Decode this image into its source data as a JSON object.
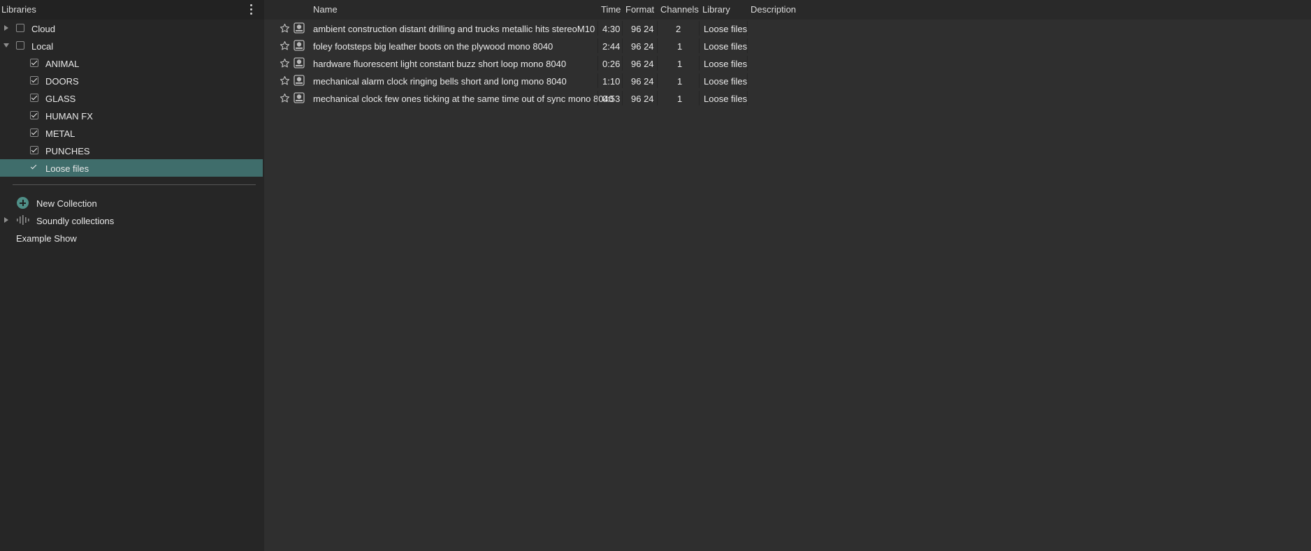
{
  "sidebar": {
    "title": "Libraries",
    "menu_icon": "vertical-ellipsis-icon",
    "tree": [
      {
        "label": "Cloud",
        "expanded": false,
        "checked": false
      },
      {
        "label": "Local",
        "expanded": true,
        "checked": false
      },
      {
        "label": "ANIMAL",
        "checked": true
      },
      {
        "label": "DOORS",
        "checked": true
      },
      {
        "label": "GLASS",
        "checked": true
      },
      {
        "label": "HUMAN FX",
        "checked": true
      },
      {
        "label": "METAL",
        "checked": true
      },
      {
        "label": "PUNCHES",
        "checked": true
      },
      {
        "label": "Loose files",
        "checked": true,
        "selected": true
      }
    ],
    "new_collection_label": "New Collection",
    "soundly_collections_label": "Soundly collections",
    "example_show_label": "Example Show"
  },
  "list": {
    "columns": [
      "Name",
      "Time",
      "Format",
      "Channels",
      "Library",
      "Description"
    ],
    "rows": [
      {
        "name": "ambient construction distant drilling and trucks metallic hits stereoM10",
        "time": "4:30",
        "format": "96 24",
        "channels": "2",
        "library": "Loose files",
        "description": ""
      },
      {
        "name": "foley footsteps big leather boots on the plywood mono 8040",
        "time": "2:44",
        "format": "96 24",
        "channels": "1",
        "library": "Loose files",
        "description": ""
      },
      {
        "name": "hardware fluorescent light constant buzz short loop mono 8040",
        "time": "0:26",
        "format": "96 24",
        "channels": "1",
        "library": "Loose files",
        "description": ""
      },
      {
        "name": "mechanical alarm clock ringing bells short and long mono 8040",
        "time": "1:10",
        "format": "96 24",
        "channels": "1",
        "library": "Loose files",
        "description": ""
      },
      {
        "name": "mechanical clock few ones ticking at the same time out of sync mono 8040",
        "time": "0:53",
        "format": "96 24",
        "channels": "1",
        "library": "Loose files",
        "description": ""
      }
    ]
  },
  "colors": {
    "selection": "#3f6d6b",
    "accent": "#4f8f87",
    "background": "#2f2f2f",
    "sidebar": "#262626"
  }
}
